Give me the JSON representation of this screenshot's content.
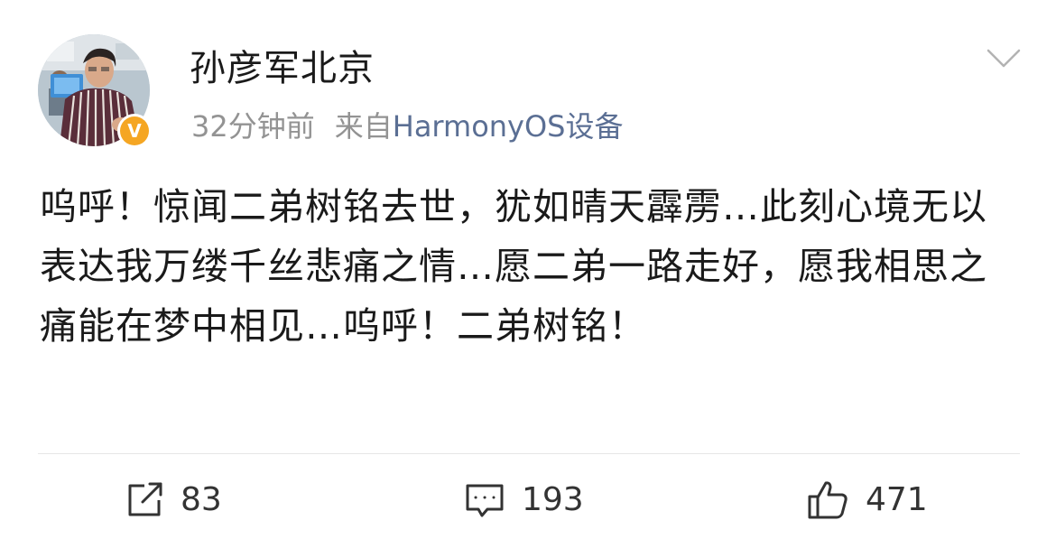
{
  "post": {
    "author": {
      "name": "孙彦军北京",
      "verified_badge": "V",
      "verified_badge_color": "#f5a623"
    },
    "meta": {
      "time": "32分钟前",
      "source_prefix": "来自",
      "source_name": "HarmonyOS设备"
    },
    "text": "呜呼！惊闻二弟树铭去世，犹如晴天霹雳…此刻心境无以表达我万缕千丝悲痛之情…愿二弟一路走好，愿我相思之痛能在梦中相见…呜呼！二弟树铭！",
    "actions": {
      "repost": {
        "icon": "repost-icon",
        "count": "83"
      },
      "comment": {
        "icon": "comment-icon",
        "count": "193"
      },
      "like": {
        "icon": "thumbs-up-icon",
        "count": "471"
      }
    },
    "more_icon": "chevron-down-icon",
    "colors": {
      "text": "#1a1a1a",
      "meta_gray": "#939393",
      "source_link": "#5b6f94",
      "divider": "#e6e6e6"
    }
  }
}
